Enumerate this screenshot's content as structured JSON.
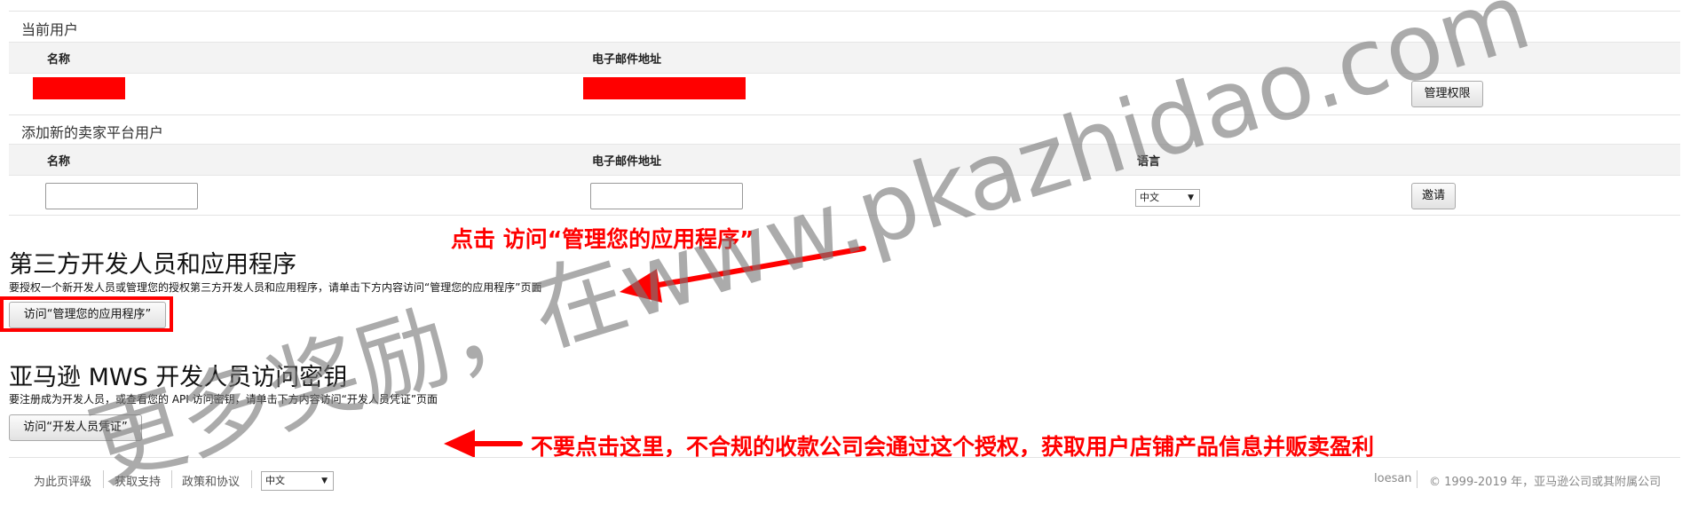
{
  "current_users": {
    "title": "当前用户",
    "col_name": "名称",
    "col_email": "电子邮件地址",
    "manage_button": "管理权限"
  },
  "add_user": {
    "title": "添加新的卖家平台用户",
    "col_name": "名称",
    "col_email": "电子邮件地址",
    "col_language": "语言",
    "language_value": "中文",
    "invite_button": "邀请"
  },
  "third_party": {
    "heading": "第三方开发人员和应用程序",
    "description": "要授权一个新开发人员或管理您的授权第三方开发人员和应用程序，请单击下方内容访问“管理您的应用程序”页面",
    "button": "访问“管理您的应用程序”"
  },
  "mws": {
    "heading": "亚马逊 MWS 开发人员访问密钥",
    "description": "要注册成为开发人员，或查看您的 API 访问密钥，请单击下方内容访问“开发人员凭证”页面",
    "button": "访问“开发人员凭证”"
  },
  "annotations": {
    "click_hint": "点击 访问“管理您的应用程序”",
    "warning": "不要点击这里，不合规的收款公司会通过这个授权，获取用户店铺产品信息并贩卖盈利"
  },
  "watermark": "更多奖励，在www.pkazhidao.com",
  "footer": {
    "links": [
      "为此页评级",
      "获取支持",
      "政策和协议"
    ],
    "language_value": "中文",
    "user": "loesan",
    "copyright": "© 1999-2019 年，亚马逊公司或其附属公司"
  },
  "colors": {
    "annotation_red": "#ff0000",
    "redaction": "#ff0000",
    "header_row_bg": "#f3f3f3"
  }
}
